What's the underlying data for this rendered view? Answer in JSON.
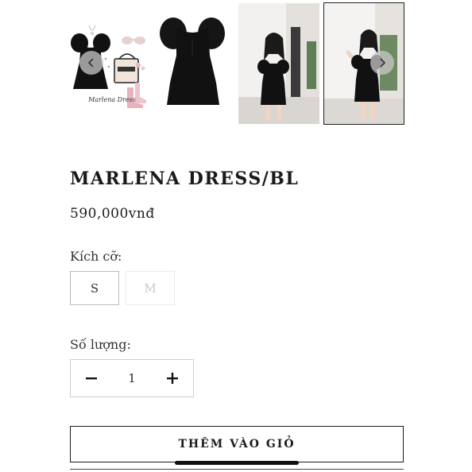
{
  "gallery": {
    "images": [
      {
        "alt": "Marlena Dress flat lay",
        "caption": "Marlena Dress"
      },
      {
        "alt": "Marlena Dress product shot"
      },
      {
        "alt": "Model wearing Marlena Dress, pose 1"
      },
      {
        "alt": "Model wearing Marlena Dress, pose 2"
      }
    ],
    "prev_icon": "chevron-left-icon",
    "next_icon": "chevron-right-icon",
    "selected_index": 3
  },
  "product": {
    "title": "MARLENA DRESS/BL",
    "price": "590,000vnđ"
  },
  "size": {
    "label": "Kích cỡ:",
    "options": [
      {
        "label": "S",
        "available": true
      },
      {
        "label": "M",
        "available": false
      }
    ]
  },
  "quantity": {
    "label": "Số lượng:",
    "value": "1",
    "minus_icon": "minus-icon",
    "plus_icon": "plus-icon"
  },
  "actions": {
    "add_to_cart_label": "THÊM VÀO GIỎ"
  },
  "colors": {
    "text": "#1a1a1a",
    "border": "#cfcfcf",
    "disabled_text": "#c9c9c9",
    "dress": "#111111"
  }
}
